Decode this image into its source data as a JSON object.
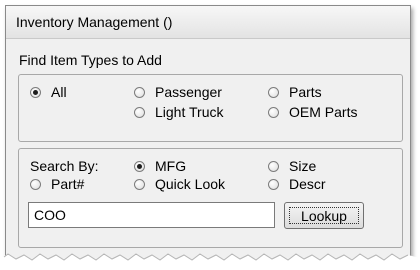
{
  "window": {
    "title": "Inventory Management ()"
  },
  "find": {
    "label": "Find Item Types to Add",
    "options": [
      {
        "label": "All",
        "checked": true
      },
      {
        "label": "Passenger",
        "checked": false
      },
      {
        "label": "Parts",
        "checked": false
      },
      {
        "label": "Light Truck",
        "checked": false
      },
      {
        "label": "OEM Parts",
        "checked": false
      }
    ]
  },
  "search": {
    "label": "Search By:",
    "options": [
      {
        "label": "MFG",
        "checked": true
      },
      {
        "label": "Size",
        "checked": false
      },
      {
        "label": "Part#",
        "checked": false
      },
      {
        "label": "Quick Look",
        "checked": false
      },
      {
        "label": "Descr",
        "checked": false
      }
    ],
    "input_value": "COO",
    "lookup_label": "Lookup"
  },
  "colors": {
    "window_bg": "#f0f0f0",
    "group_border": "#a8a8a8"
  }
}
